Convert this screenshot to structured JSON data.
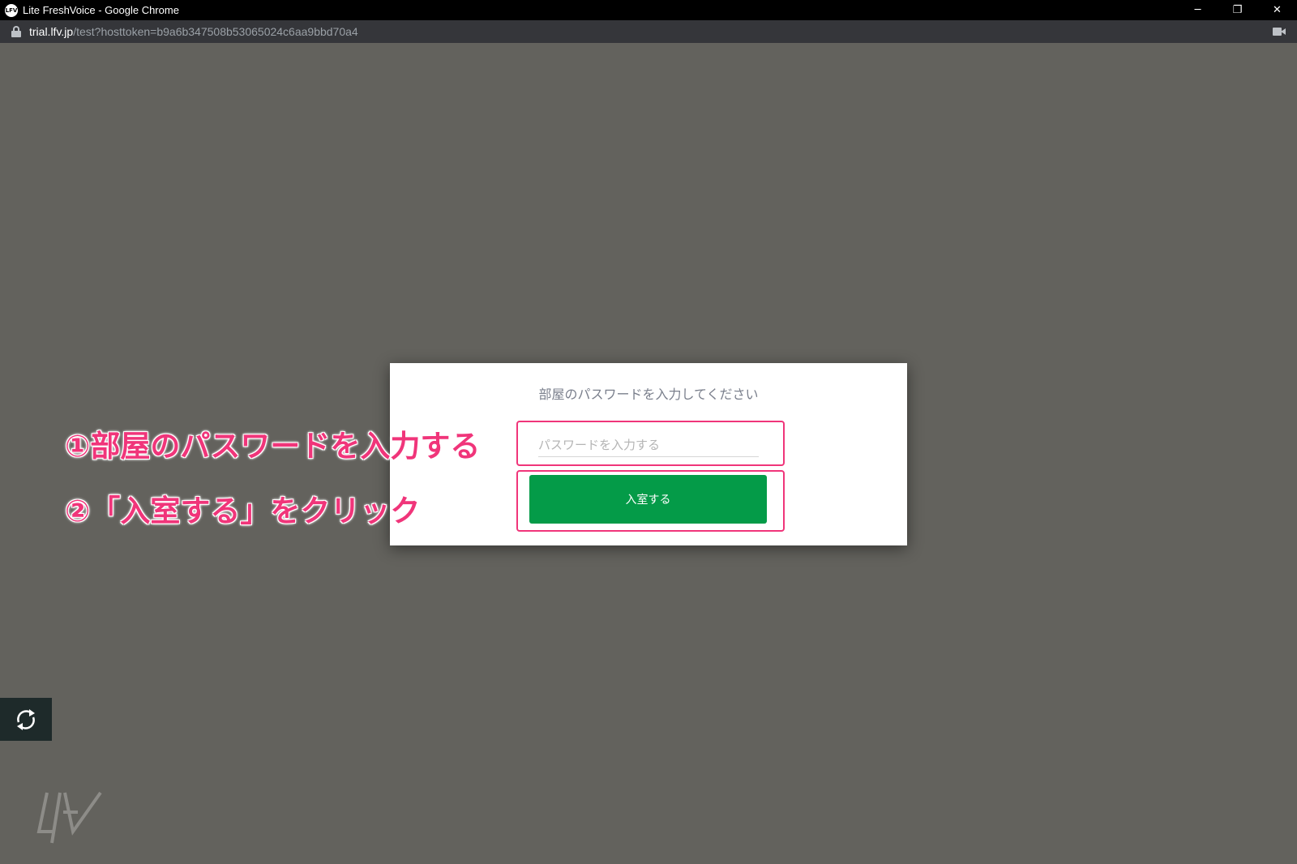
{
  "window": {
    "title": "Lite FreshVoice - Google Chrome",
    "app_icon_text": "LFV",
    "minimize": "─",
    "restore": "❐",
    "close": "✕"
  },
  "address_bar": {
    "host": "trial.lfv.jp",
    "path": "/test?hosttoken=b9a6b347508b53065024c6aa9bbd70a4"
  },
  "modal": {
    "title": "部屋のパスワードを入力してください",
    "password_placeholder": "パスワードを入力する",
    "password_value": "",
    "enter_button": "入室する",
    "button_color": "#049b48"
  },
  "annotations": {
    "step1": "①部屋のパスワードを入力する",
    "step2": "②「入室する」をクリック",
    "color": "#f0357a"
  },
  "widgets": {
    "refresh_icon": "refresh-icon",
    "logo_text": "LFV"
  }
}
